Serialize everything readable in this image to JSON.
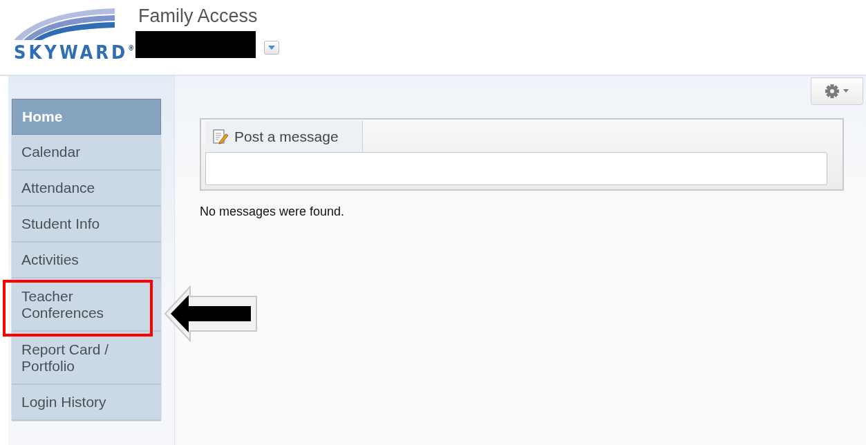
{
  "header": {
    "logo": "SKYWARD",
    "logo_mark": "®",
    "title": "Family Access"
  },
  "nav": [
    {
      "label": "Home",
      "selected": true,
      "highlighted": false
    },
    {
      "label": "Calendar",
      "selected": false,
      "highlighted": false
    },
    {
      "label": "Attendance",
      "selected": false,
      "highlighted": false
    },
    {
      "label": "Student Info",
      "selected": false,
      "highlighted": false
    },
    {
      "label": "Activities",
      "selected": false,
      "highlighted": false
    },
    {
      "label": "Teacher Conferences",
      "selected": false,
      "highlighted": true
    },
    {
      "label": "Report Card / Portfolio",
      "selected": false,
      "highlighted": false
    },
    {
      "label": "Login History",
      "selected": false,
      "highlighted": false
    }
  ],
  "message_panel": {
    "tab": "Post a message"
  },
  "empty_text": "No messages were found."
}
